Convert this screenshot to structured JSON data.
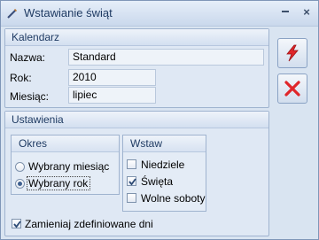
{
  "window": {
    "title": "Wstawianie świąt",
    "close_symbol": "×",
    "minimize_symbol": "×"
  },
  "kalendarz": {
    "header": "Kalendarz",
    "nazwa_label": "Nazwa:",
    "nazwa_value": "Standard",
    "rok_label": "Rok:",
    "rok_value": "2010",
    "miesiac_label": "Miesiąc:",
    "miesiac_value": "lipiec"
  },
  "ustawienia": {
    "header": "Ustawienia",
    "okres": {
      "header": "Okres",
      "options": [
        "Wybrany miesiąc",
        "Wybrany rok"
      ],
      "selected": "Wybrany rok"
    },
    "wstaw": {
      "header": "Wstaw",
      "items": [
        {
          "label": "Niedziele",
          "checked": false
        },
        {
          "label": "Święta",
          "checked": true
        },
        {
          "label": "Wolne soboty",
          "checked": false
        }
      ]
    },
    "zamieniaj_label": "Zamieniaj zdefiniowane dni",
    "zamieniaj_checked": true
  },
  "actions": {
    "confirm_icon": "lightning-icon",
    "cancel_icon": "red-x-icon"
  },
  "colors": {
    "accent_red": "#e0262a",
    "header_text": "#1f3b63"
  }
}
